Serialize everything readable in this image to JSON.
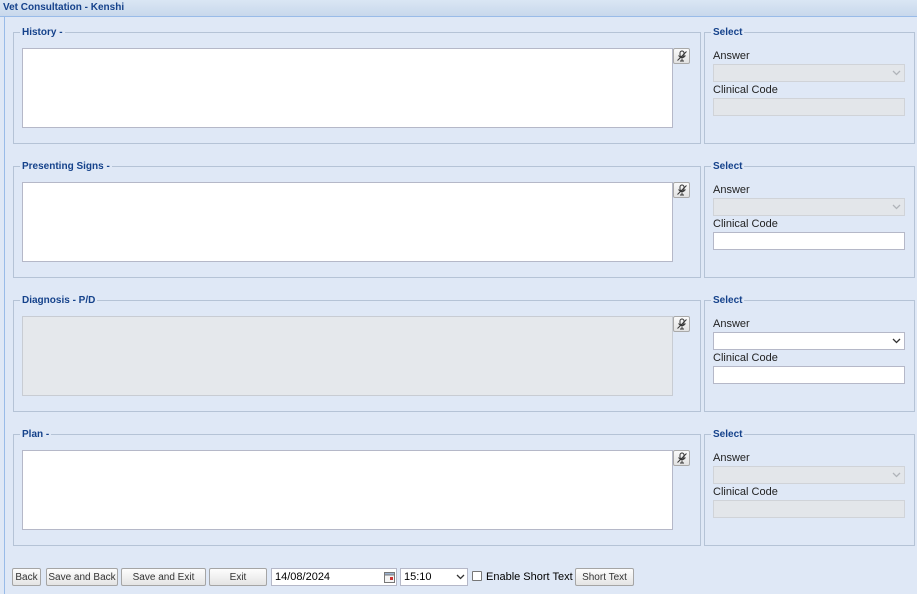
{
  "window": {
    "title": "Vet Consultation - Kenshi"
  },
  "sections": [
    {
      "label": "History -",
      "panel_title": "Select",
      "answer_label": "Answer",
      "code_label": "Clinical Code"
    },
    {
      "label": "Presenting Signs -",
      "panel_title": "Select",
      "answer_label": "Answer",
      "code_label": "Clinical Code"
    },
    {
      "label": "Diagnosis - P/D",
      "panel_title": "Select",
      "answer_label": "Answer",
      "code_label": "Clinical Code"
    },
    {
      "label": "Plan -",
      "panel_title": "Select",
      "answer_label": "Answer",
      "code_label": "Clinical Code"
    }
  ],
  "icons": {
    "dictation": "microphone-off-icon",
    "calendar": "calendar-icon",
    "dropdown": "chevron-down-icon"
  },
  "footer": {
    "back_label": "Back",
    "save_back_label": "Save and Back",
    "save_exit_label": "Save and Exit",
    "exit_label": "Exit",
    "date_value": "14/08/2024",
    "time_value": "15:10",
    "short_text_checkbox_label": "Enable Short Text",
    "short_text_button_label": "Short Text"
  },
  "colors": {
    "background": "#dfe8f6",
    "heading": "#15428b",
    "border": "#b5c3d6"
  }
}
